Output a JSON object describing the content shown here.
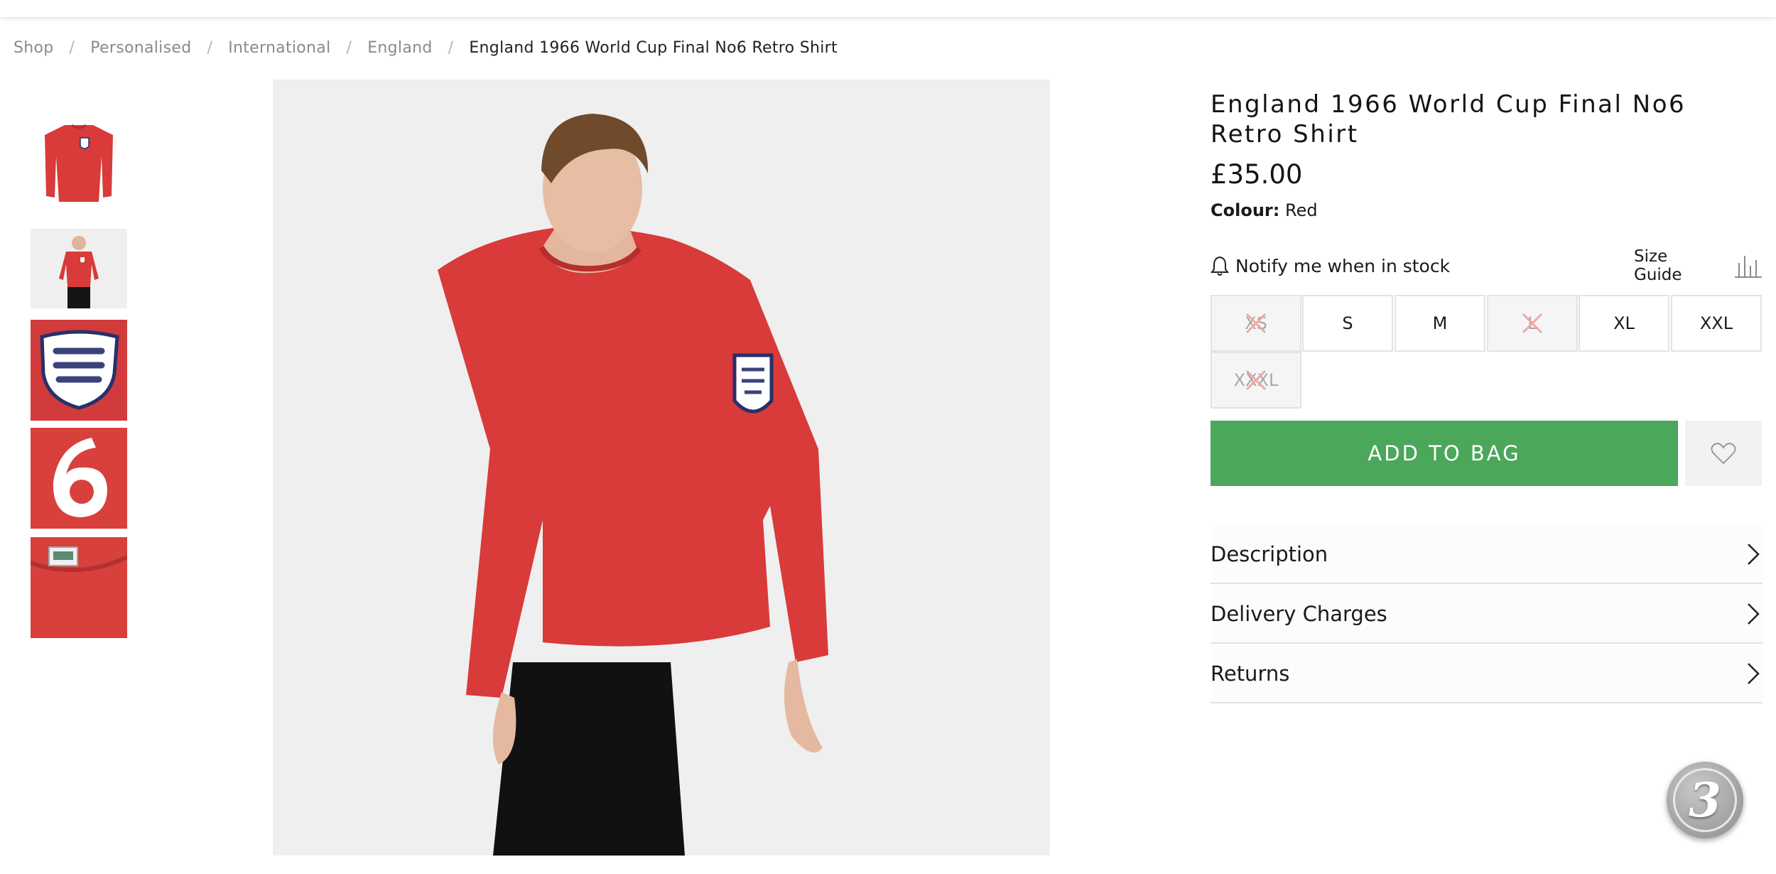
{
  "breadcrumb": {
    "items": [
      "Shop",
      "Personalised",
      "International",
      "England"
    ],
    "current": "England 1966 World Cup Final No6 Retro Shirt",
    "separator": "/"
  },
  "product": {
    "title": "England 1966 World Cup Final No6 Retro Shirt",
    "price": "£35.00",
    "colour_label": "Colour:",
    "colour_value": "Red"
  },
  "stock": {
    "notify_label": "Notify me when in stock",
    "size_guide_label": "Size Guide"
  },
  "sizes": [
    {
      "label": "XS",
      "available": false
    },
    {
      "label": "S",
      "available": true
    },
    {
      "label": "M",
      "available": true
    },
    {
      "label": "L",
      "available": false
    },
    {
      "label": "XL",
      "available": true
    },
    {
      "label": "XXL",
      "available": true
    },
    {
      "label": "XXXL",
      "available": false
    }
  ],
  "actions": {
    "add_to_bag_label": "ADD TO BAG"
  },
  "accordions": [
    {
      "label": "Description"
    },
    {
      "label": "Delivery Charges"
    },
    {
      "label": "Returns"
    }
  ],
  "badge": {
    "label": "3"
  },
  "icons": {
    "notify": "bell-icon",
    "size_guide": "ruler-chart-icon",
    "wishlist": "heart-icon",
    "accordion": "chevron-right-icon",
    "out_of_stock": "cross-icon"
  },
  "colors": {
    "add_to_bag_bg": "#4ba75a",
    "shirt_red": "#d93a3a",
    "out_of_stock_cross": "#f0a7a7"
  }
}
